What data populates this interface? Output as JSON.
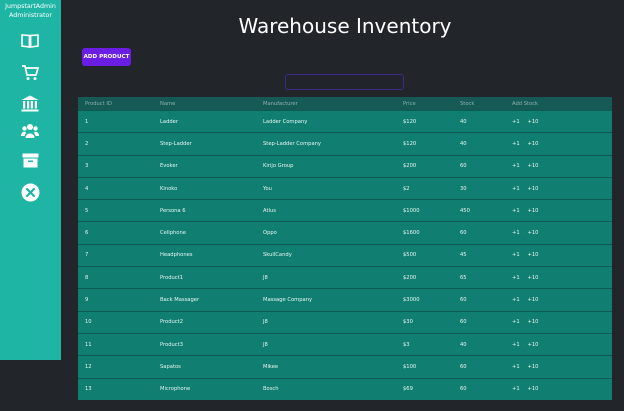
{
  "sidebar": {
    "user_name": "JumpstartAdmin",
    "user_role": "Administrator",
    "items": [
      {
        "icon": "book-open-icon"
      },
      {
        "icon": "shopping-cart-icon"
      },
      {
        "icon": "bank-icon"
      },
      {
        "icon": "users-icon"
      },
      {
        "icon": "archive-box-icon"
      },
      {
        "icon": "close-circle-icon"
      }
    ]
  },
  "header": {
    "title": "Warehouse Inventory"
  },
  "toolbar": {
    "add_label": "ADD PRODUCT"
  },
  "search": {
    "value": "",
    "placeholder": ""
  },
  "table": {
    "columns": [
      "Product ID",
      "Name",
      "Manufacturer",
      "Price",
      "Stock",
      "Add Stock"
    ],
    "add_stock": {
      "plus1": "+1",
      "minus": "-",
      "plus10": "+10"
    },
    "rows": [
      {
        "id": "1",
        "name": "Ladder",
        "manufacturer": "Ladder Company",
        "price": "$120",
        "stock": "40"
      },
      {
        "id": "2",
        "name": "Step-Ladder",
        "manufacturer": "Step-Ladder Company",
        "price": "$120",
        "stock": "40"
      },
      {
        "id": "3",
        "name": "Evoker",
        "manufacturer": "Kirijo Group",
        "price": "$200",
        "stock": "60"
      },
      {
        "id": "4",
        "name": "Kinoko",
        "manufacturer": "You",
        "price": "$2",
        "stock": "30"
      },
      {
        "id": "5",
        "name": "Persona 6",
        "manufacturer": "Atlus",
        "price": "$1000",
        "stock": "450"
      },
      {
        "id": "6",
        "name": "Cellphone",
        "manufacturer": "Oppo",
        "price": "$1600",
        "stock": "60"
      },
      {
        "id": "7",
        "name": "Headphones",
        "manufacturer": "SkullCandy",
        "price": "$500",
        "stock": "45"
      },
      {
        "id": "8",
        "name": "Product1",
        "manufacturer": "J8",
        "price": "$200",
        "stock": "65"
      },
      {
        "id": "9",
        "name": "Back Massager",
        "manufacturer": "Massage Company",
        "price": "$3000",
        "stock": "60"
      },
      {
        "id": "10",
        "name": "Product2",
        "manufacturer": "J8",
        "price": "$30",
        "stock": "60"
      },
      {
        "id": "11",
        "name": "Product3",
        "manufacturer": "J8",
        "price": "$3",
        "stock": "40"
      },
      {
        "id": "12",
        "name": "Sapatos",
        "manufacturer": "Mikee",
        "price": "$100",
        "stock": "60"
      },
      {
        "id": "13",
        "name": "Microphone",
        "manufacturer": "Bosch",
        "price": "$69",
        "stock": "60"
      }
    ]
  }
}
